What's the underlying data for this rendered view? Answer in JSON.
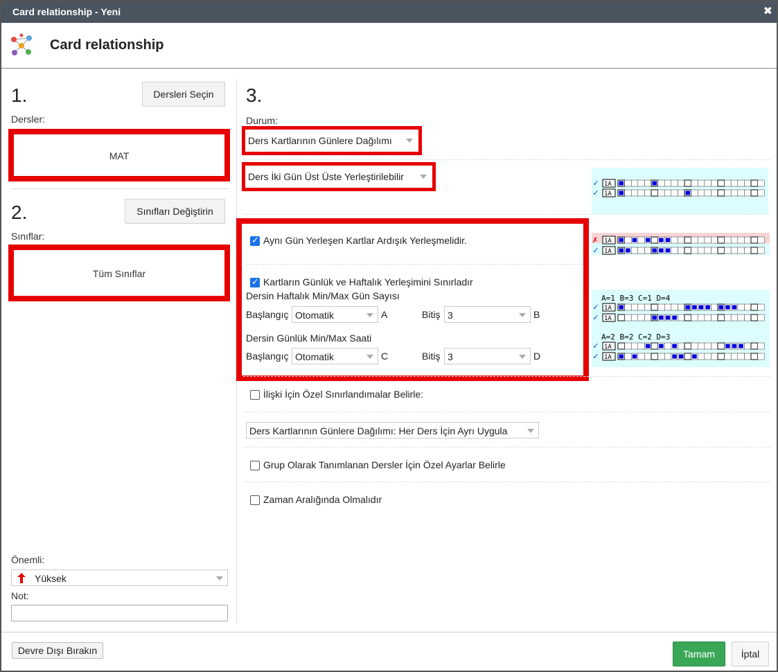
{
  "window": {
    "title": "Card relationship - Yeni",
    "close_glyph": "✖"
  },
  "header": {
    "title": "Card relationship",
    "logo_icon": "network-nodes-icon"
  },
  "step1": {
    "number": "1.",
    "button": "Dersleri Seçin",
    "label": "Dersler:",
    "value": "MAT"
  },
  "step2": {
    "number": "2.",
    "button": "Sınıfları Değiştirin",
    "label": "Sınıflar:",
    "value": "Tüm Sınıflar"
  },
  "priority": {
    "label": "Önemli:",
    "value": "Yüksek",
    "icon": "arrow-up-icon",
    "note_label": "Not:",
    "note_value": ""
  },
  "step3": {
    "number": "3.",
    "durum_label": "Durum:",
    "durum_value": "Ders Kartlarının Günlere Dağılımı",
    "consecutive_value": "Ders İki Gün Üst Üste Yerleştirilebilir",
    "same_day": {
      "checked": true,
      "label": "Aynı Gün Yerleşen Kartlar Ardışık Yerleşmelidir."
    },
    "limit": {
      "checked": true,
      "label": "Kartların Günlük ve Haftalık Yerleşimini Sınırladır",
      "weekly_title": "Dersin Haftalık Min/Max Gün Sayısı",
      "daily_title": "Dersin Günlük Min/Max Saati",
      "start_label": "Başlangıç",
      "end_label": "Bitiş",
      "weekly_start": "Otomatik",
      "weekly_start_letter": "A",
      "weekly_end": "3",
      "weekly_end_letter": "B",
      "daily_start": "Otomatik",
      "daily_start_letter": "C",
      "daily_end": "3",
      "daily_end_letter": "D"
    },
    "special_limits": {
      "checked": false,
      "label": "İlişki İçin Özel Sınırlandımalar Belirle:"
    },
    "apply_mode": "Ders Kartlarının Günlere Dağılımı: Her Ders İçin Ayrı Uygula",
    "group_settings": {
      "checked": false,
      "label": "Grup Olarak Tanımlanan Dersler İçin Özel Ayarlar Belirle"
    },
    "time_range": {
      "checked": false,
      "label": "Zaman Aralığında Olmalıdır"
    }
  },
  "illustrations": {
    "row_label": "1A",
    "ok_mark": "✓",
    "bad_mark": "✗",
    "caption1": "A=1 B=3 C=1 D=4",
    "caption2": "A=2 B=2 C=2 D=3"
  },
  "footer": {
    "disable": "Devre Dışı Bırakın",
    "ok": "Tamam",
    "cancel": "İptal"
  },
  "colors": {
    "red_frame": "#e60000",
    "ok_green": "#3aa757",
    "checkbox_blue": "#1a73e8",
    "illustration_bg": "#dcfcfd",
    "cell_blue": "#0000dd"
  }
}
